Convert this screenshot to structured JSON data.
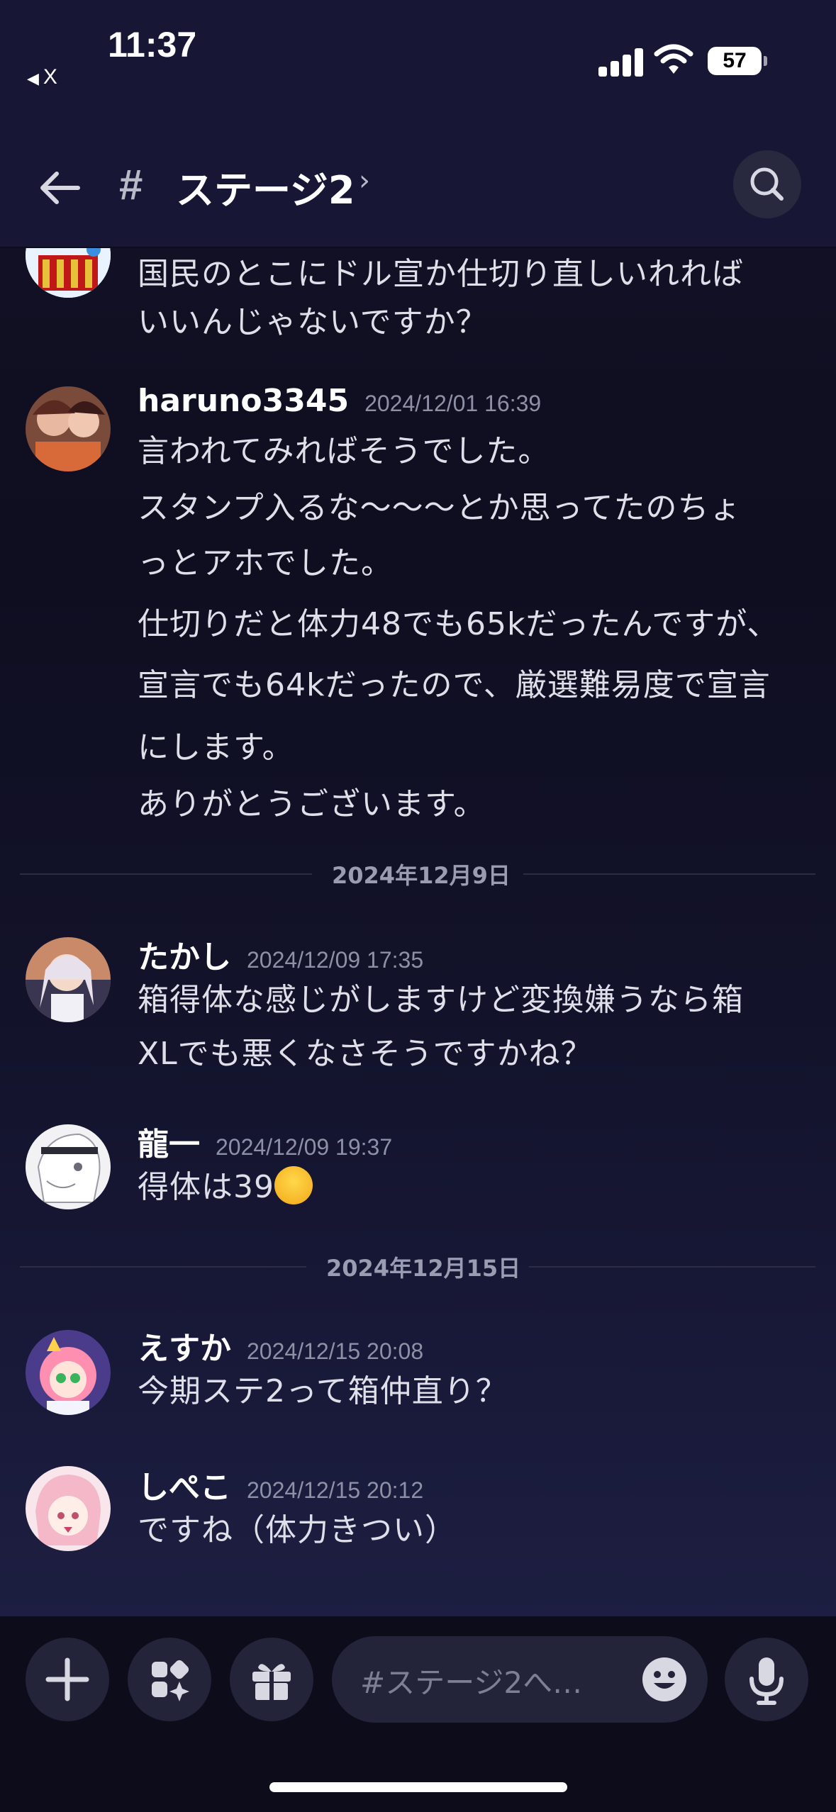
{
  "status_bar": {
    "time": "11:37",
    "back_app": "X",
    "battery": "57"
  },
  "header": {
    "channel_name": "ステージ2",
    "chevron": "›"
  },
  "messages": [
    {
      "user": "",
      "time": "",
      "lines": [
        "国民のとこにドル宣か仕切り直しいれれば",
        "いいんじゃないですか？"
      ]
    },
    {
      "user": "haruno3345",
      "time": "2024/12/01 16:39",
      "lines": [
        "言われてみればそうでした。",
        "スタンプ入るな〜〜〜とか思ってたのちょ",
        "っとアホでした。",
        "仕切りだと体力48でも65kだったんですが、",
        "宣言でも64kだったので、厳選難易度で宣言",
        "にします。",
        "ありがとうございます。"
      ]
    },
    {
      "user": "たかし",
      "time": "2024/12/09 17:35",
      "lines": [
        "箱得体な感じがしますけど変換嫌うなら箱",
        "XLでも悪くなさそうですかね？"
      ]
    },
    {
      "user": "龍一",
      "time": "2024/12/09 19:37",
      "lines": [
        "得体は39"
      ]
    },
    {
      "user": "えすか",
      "time": "2024/12/15 20:08",
      "lines": [
        "今期ステ2って箱仲直り？"
      ]
    },
    {
      "user": "しぺこ",
      "time": "2024/12/15 20:12",
      "lines": [
        "ですね（体力きつい）"
      ]
    }
  ],
  "date_dividers": [
    "2024年12月9日",
    "2024年12月15日"
  ],
  "composer": {
    "placeholder": "#ステージ2へ…"
  },
  "icons": {
    "back": "arrow-left-icon",
    "hash": "hash-icon",
    "search": "search-icon",
    "add": "plus-icon",
    "apps": "sparkle-apps-icon",
    "gift": "gift-icon",
    "emoji": "smiley-icon",
    "mic": "microphone-icon"
  },
  "colors": {
    "background": "#141228",
    "header": "#171634",
    "bubble_button": "#23233a",
    "muted_text": "#8e90a6"
  }
}
